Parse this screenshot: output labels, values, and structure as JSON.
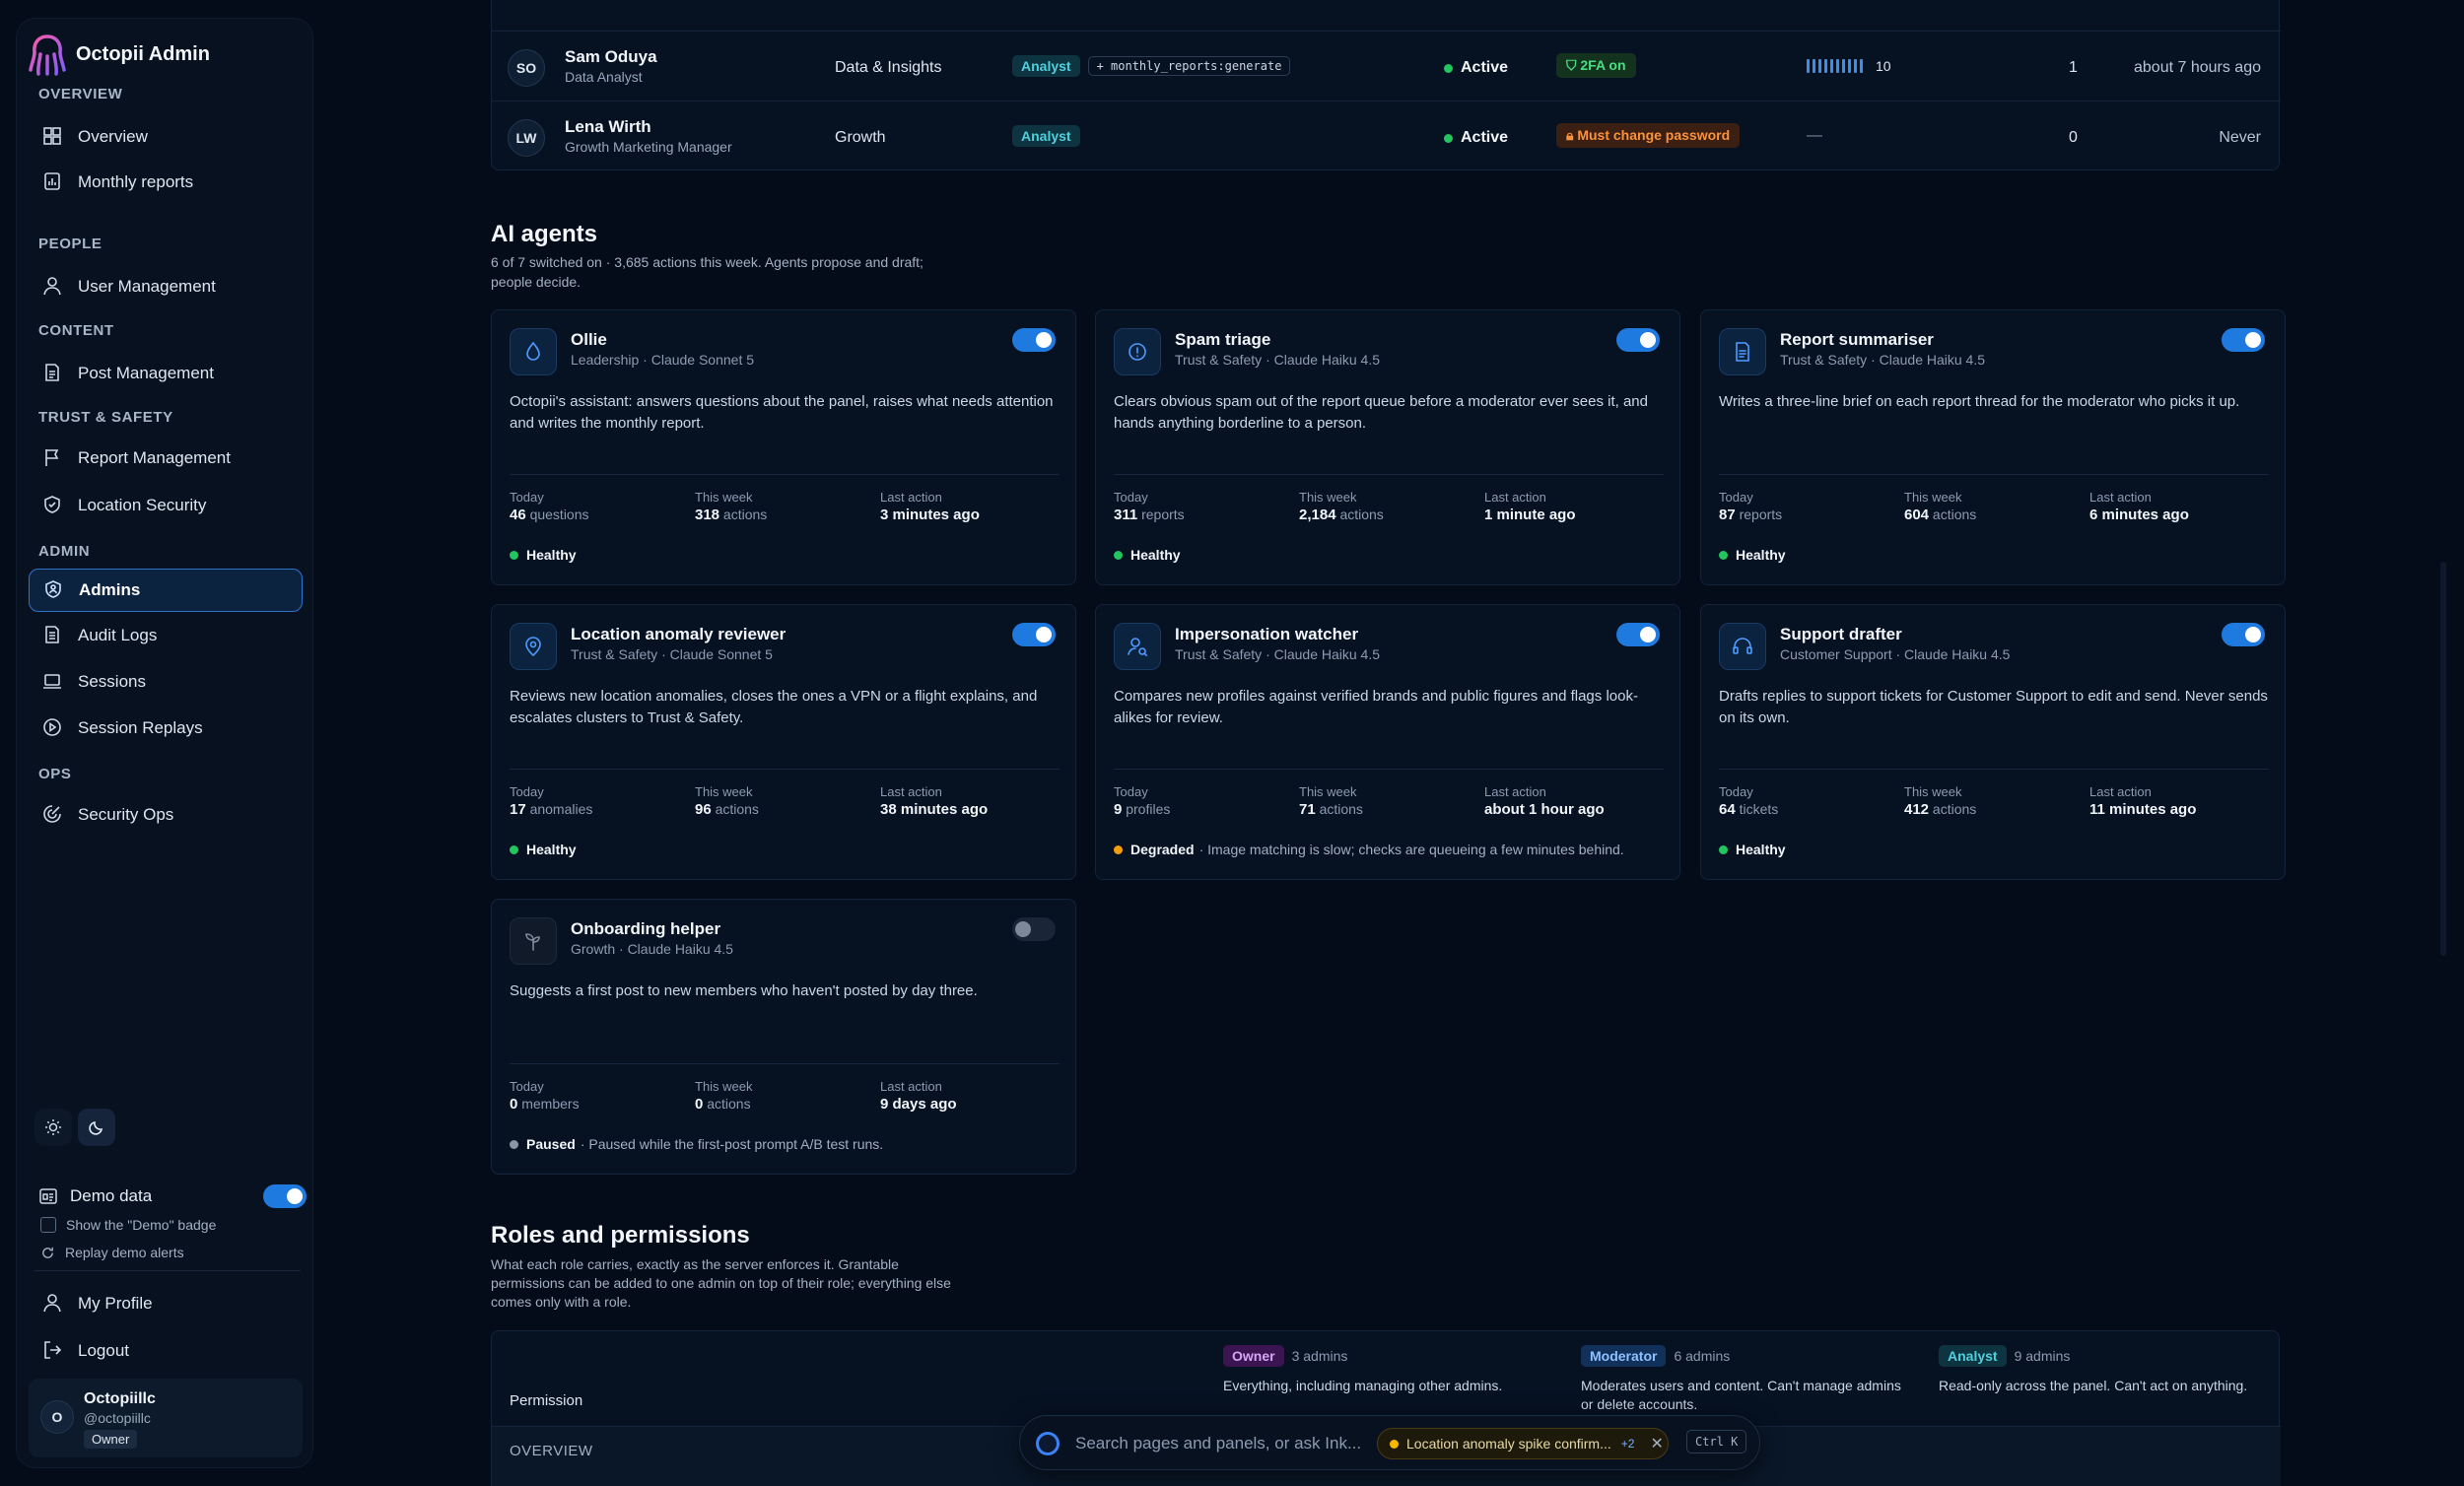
{
  "brand": {
    "title": "Octopii Admin"
  },
  "sidebar": {
    "sections": [
      "OVERVIEW",
      "PEOPLE",
      "CONTENT",
      "TRUST & SAFETY",
      "ADMIN",
      "OPS"
    ],
    "items": [
      {
        "label": "Overview"
      },
      {
        "label": "Monthly reports"
      },
      {
        "label": "User Management"
      },
      {
        "label": "Post Management"
      },
      {
        "label": "Report Management"
      },
      {
        "label": "Location Security"
      },
      {
        "label": "Admins"
      },
      {
        "label": "Audit Logs"
      },
      {
        "label": "Sessions"
      },
      {
        "label": "Session Replays"
      },
      {
        "label": "Security Ops"
      }
    ],
    "demo_label": "Demo data",
    "demo_on": true,
    "show_badge_label": "Show the \"Demo\" badge",
    "replay_label": "Replay demo alerts",
    "profile_label": "My Profile",
    "logout_label": "Logout",
    "user": {
      "initial": "O",
      "name": "Octopiillc",
      "handle": "@octopiillc",
      "role": "Owner"
    }
  },
  "admins_table": {
    "rows": [
      {
        "initials": "SO",
        "name": "Sam Oduya",
        "title": "Data Analyst",
        "dept": "Data & Insights",
        "role": "Analyst",
        "extra_perm": "+ monthly_reports:generate",
        "status": "Active",
        "security": "2FA on",
        "activity": "10",
        "count": "1",
        "last": "about 7 hours ago"
      },
      {
        "initials": "LW",
        "name": "Lena Wirth",
        "title": "Growth Marketing Manager",
        "dept": "Growth",
        "role": "Analyst",
        "extra_perm": "",
        "status": "Active",
        "security": "Must change password",
        "activity": "—",
        "count": "0",
        "last": "Never"
      }
    ]
  },
  "agents": {
    "title": "AI agents",
    "subtitle_1": "6 of 7 switched on · 3,685 actions this week. Agents propose and draft;",
    "subtitle_2": "people decide.",
    "stat_labels": {
      "today": "Today",
      "week": "This week",
      "last": "Last action"
    },
    "cards": [
      {
        "name": "Ollie",
        "meta": "Leadership · Claude Sonnet 5",
        "desc": "Octopii's assistant: answers questions about the panel, raises what needs attention and writes the monthly report.",
        "today": "46",
        "today_unit": "questions",
        "week": "318",
        "week_unit": "actions",
        "last": "3 minutes ago",
        "health": "Healthy",
        "health_note": "",
        "enabled": true,
        "icon": "droplet-icon"
      },
      {
        "name": "Spam triage",
        "meta": "Trust & Safety · Claude Haiku 4.5",
        "desc": "Clears obvious spam out of the report queue before a moderator ever sees it, and hands anything borderline to a person.",
        "today": "311",
        "today_unit": "reports",
        "week": "2,184",
        "week_unit": "actions",
        "last": "1 minute ago",
        "health": "Healthy",
        "health_note": "",
        "enabled": true,
        "icon": "alert-circle-icon"
      },
      {
        "name": "Report summariser",
        "meta": "Trust & Safety · Claude Haiku 4.5",
        "desc": "Writes a three-line brief on each report thread for the moderator who picks it up.",
        "today": "87",
        "today_unit": "reports",
        "week": "604",
        "week_unit": "actions",
        "last": "6 minutes ago",
        "health": "Healthy",
        "health_note": "",
        "enabled": true,
        "icon": "document-icon"
      },
      {
        "name": "Location anomaly reviewer",
        "meta": "Trust & Safety · Claude Sonnet 5",
        "desc": "Reviews new location anomalies, closes the ones a VPN or a flight explains, and escalates clusters to Trust & Safety.",
        "today": "17",
        "today_unit": "anomalies",
        "week": "96",
        "week_unit": "actions",
        "last": "38 minutes ago",
        "health": "Healthy",
        "health_note": "",
        "enabled": true,
        "icon": "location-pin-icon"
      },
      {
        "name": "Impersonation watcher",
        "meta": "Trust & Safety · Claude Haiku 4.5",
        "desc": "Compares new profiles against verified brands and public figures and flags look-alikes for review.",
        "today": "9",
        "today_unit": "profiles",
        "week": "71",
        "week_unit": "actions",
        "last": "about 1 hour ago",
        "health": "Degraded",
        "health_note": "· Image matching is slow; checks are queueing a few minutes behind.",
        "enabled": true,
        "icon": "user-search-icon"
      },
      {
        "name": "Support drafter",
        "meta": "Customer Support · Claude Haiku 4.5",
        "desc": "Drafts replies to support tickets for Customer Support to edit and send. Never sends on its own.",
        "today": "64",
        "today_unit": "tickets",
        "week": "412",
        "week_unit": "actions",
        "last": "11 minutes ago",
        "health": "Healthy",
        "health_note": "",
        "enabled": true,
        "icon": "headset-icon"
      },
      {
        "name": "Onboarding helper",
        "meta": "Growth · Claude Haiku 4.5",
        "desc": "Suggests a first post to new members who haven't posted by day three.",
        "today": "0",
        "today_unit": "members",
        "week": "0",
        "week_unit": "actions",
        "last": "9 days ago",
        "health": "Paused",
        "health_note": "· Paused while the first-post prompt A/B test runs.",
        "enabled": false,
        "icon": "sprout-icon"
      }
    ]
  },
  "roles": {
    "title": "Roles and permissions",
    "subtitle_1": "What each role carries, exactly as the server enforces it. Grantable",
    "subtitle_2": "permissions can be added to one admin on top of their role; everything else",
    "subtitle_3": "comes only with a role.",
    "permission_header": "Permission",
    "section_overview": "OVERVIEW",
    "columns": [
      {
        "role": "Owner",
        "count": "3 admins",
        "desc": "Everything, including managing other admins."
      },
      {
        "role": "Moderator",
        "count": "6 admins",
        "desc": "Moderates users and content. Can't manage admins or delete accounts."
      },
      {
        "role": "Analyst",
        "count": "9 admins",
        "desc": "Read-only across the panel. Can't act on anything."
      }
    ]
  },
  "command_bar": {
    "placeholder": "Search pages and panels, or ask Ink...",
    "alert": "Location anomaly spike confirm...",
    "alert_more": "+2",
    "shortcut": "Ctrl K"
  },
  "colors": {
    "accent": "#1f7ae0",
    "healthy": "#22c55e",
    "degraded": "#f59e0b",
    "paused": "#8a94a3"
  }
}
